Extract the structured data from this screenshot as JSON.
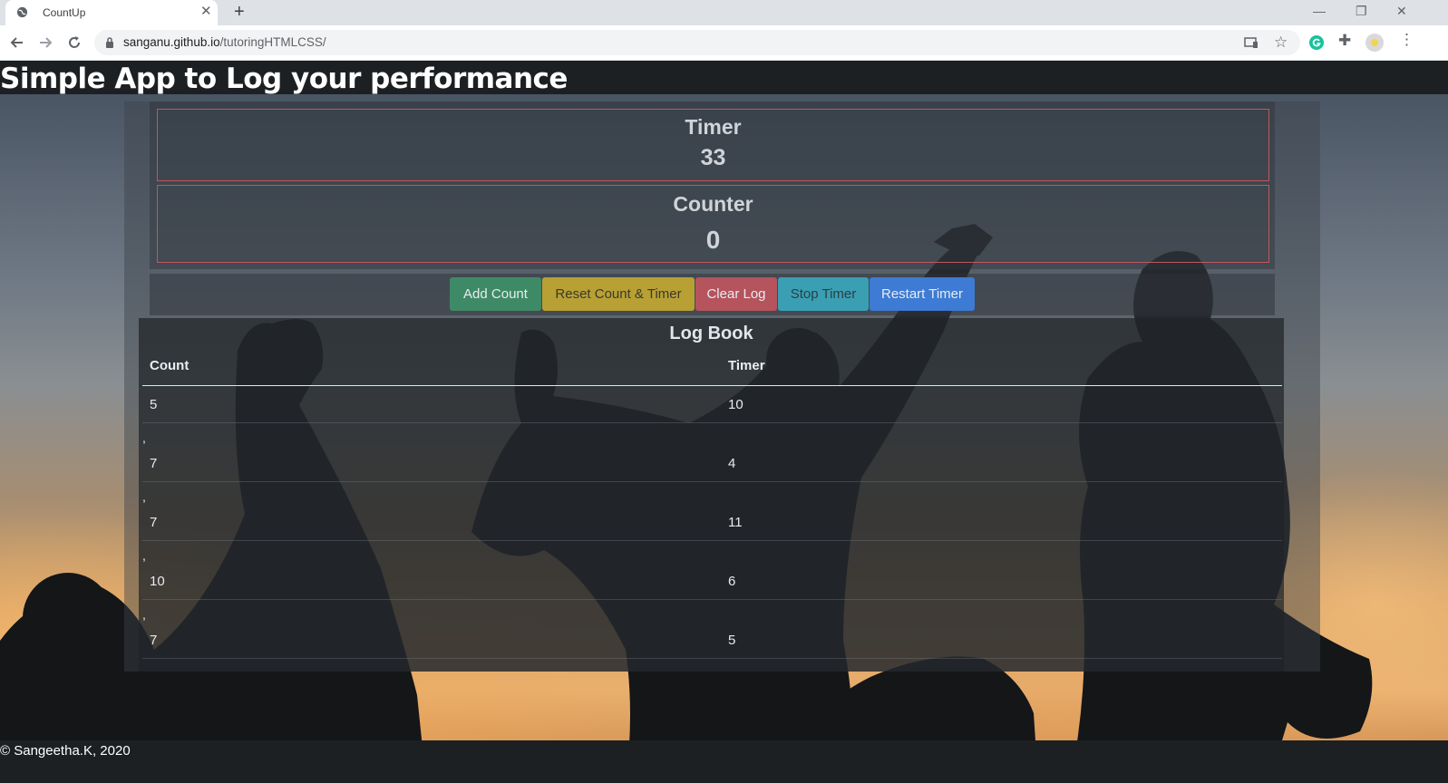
{
  "browser": {
    "tab_title": "CountUp",
    "new_tab_label": "+",
    "url_host": "sanganu.github.io",
    "url_path": "/tutoringHTMLCSS/"
  },
  "page": {
    "title": "Simple App to Log your performance",
    "timer": {
      "label": "Timer",
      "value": "33"
    },
    "counter": {
      "label": "Counter",
      "value": "0"
    },
    "buttons": {
      "add": "Add Count",
      "reset": "Reset Count & Timer",
      "clear": "Clear Log",
      "stop": "Stop Timer",
      "restart": "Restart Timer"
    },
    "button_colors": {
      "add": "#3f8a66",
      "reset": "#b8a034",
      "clear": "#b5545d",
      "stop": "#3a9fb3",
      "restart": "#3d7bd4"
    },
    "log": {
      "title": "Log Book",
      "headers": [
        "Count",
        "Timer"
      ],
      "separator": ",",
      "rows": [
        {
          "count": "5",
          "timer": "10"
        },
        {
          "count": "7",
          "timer": "4"
        },
        {
          "count": "7",
          "timer": "11"
        },
        {
          "count": "10",
          "timer": "6"
        },
        {
          "count": "7",
          "timer": "5"
        }
      ]
    },
    "footer": "© Sangeetha.K, 2020"
  }
}
